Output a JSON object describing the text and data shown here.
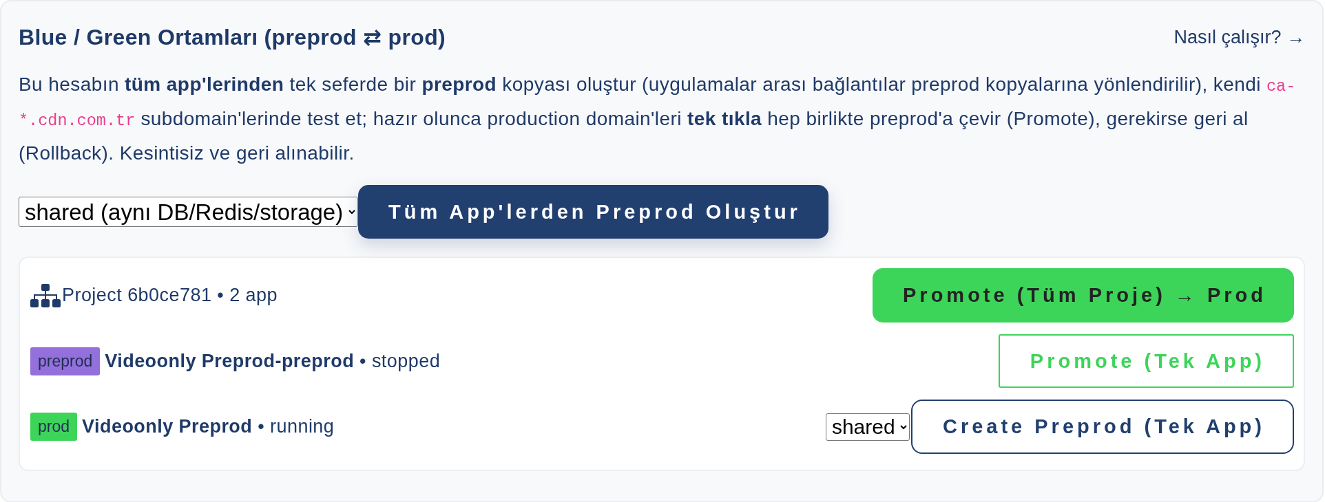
{
  "header": {
    "title": "Blue / Green Ortamları (preprod ⇄ prod)",
    "help_link": "Nasıl çalışır? →"
  },
  "description": [
    {
      "kind": "text",
      "text": "Bu hesabın **tüm app'lerinden** tek seferde bir **preprod** kopyası oluştur (uygulamalar arası bağlantılar preprod kopyalarına yönlendirilir), kendi "
    },
    {
      "kind": "code",
      "text": "ca-*.cdn.com.tr"
    },
    {
      "kind": "text",
      "text": " subdomain'lerinde test et; hazır olunca production domain'leri **tek tıkla** hep birlikte preprod'a çevir (Promote), gerekirse geri al (Rollback). Kesintisiz ve geri alınabilir."
    }
  ],
  "toolbar": {
    "mode_select": {
      "value": "shared (aynı DB/Redis/storage)"
    },
    "button": {
      "label": "Tüm App'lerden Preprod Oluştur",
      "kind": "create-all"
    }
  },
  "project": {
    "summary": "Project 6b0ce781 • 2 app",
    "button": {
      "label": "Promote (Tüm Proje) → Prod",
      "kind": "promote-all"
    }
  },
  "apps": [
    {
      "badge": {
        "label": "preprod",
        "color": "#9370db"
      },
      "title": "**Videoonly Preprod-preprod** • stopped",
      "actions": [
        {
          "kind": "promote",
          "label": "Promote (Tek App)"
        }
      ]
    },
    {
      "badge": {
        "label": "prod",
        "color": "#3dd45a"
      },
      "title": "**Videoonly Preprod** • running",
      "actions": [
        {
          "kind": "select",
          "value": "shared"
        },
        {
          "kind": "create",
          "label": "Create Preprod (Tek App)"
        }
      ]
    }
  ]
}
